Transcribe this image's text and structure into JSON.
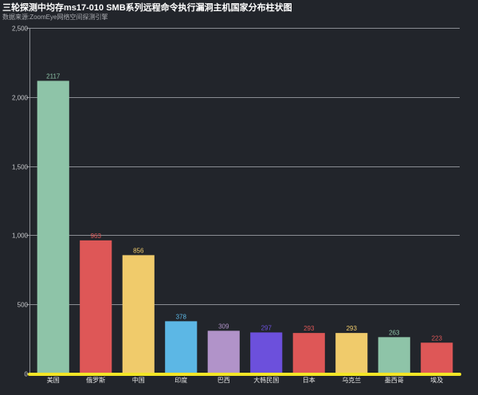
{
  "theme": {
    "background": "#22252b",
    "baseline": "#f3e526"
  },
  "chart_data": {
    "type": "bar",
    "title": "三轮探测中均存ms17-010 SMB系列远程命令执行漏洞主机国家分布柱状图",
    "subtitle": "数据来源:ZoomEye网络空间探测引擎",
    "categories": [
      "美国",
      "俄罗斯",
      "中国",
      "印度",
      "巴西",
      "大韩民国",
      "日本",
      "乌克兰",
      "墨西哥",
      "埃及"
    ],
    "values": [
      2117,
      963,
      856,
      378,
      309,
      297,
      293,
      293,
      263,
      223
    ],
    "colors": [
      "#8ec4a8",
      "#de5757",
      "#f0cb6b",
      "#5cb7e5",
      "#b193c9",
      "#6c50dc",
      "#de5757",
      "#f0cb6b",
      "#8ec4a8",
      "#de5757"
    ],
    "ylim": [
      0,
      2500
    ],
    "yticks": [
      0,
      500,
      1000,
      1500,
      2000,
      2500
    ],
    "ytick_labels": [
      "0",
      "500",
      "1,000",
      "1,500",
      "2,000",
      "2,500"
    ],
    "grid": true
  }
}
